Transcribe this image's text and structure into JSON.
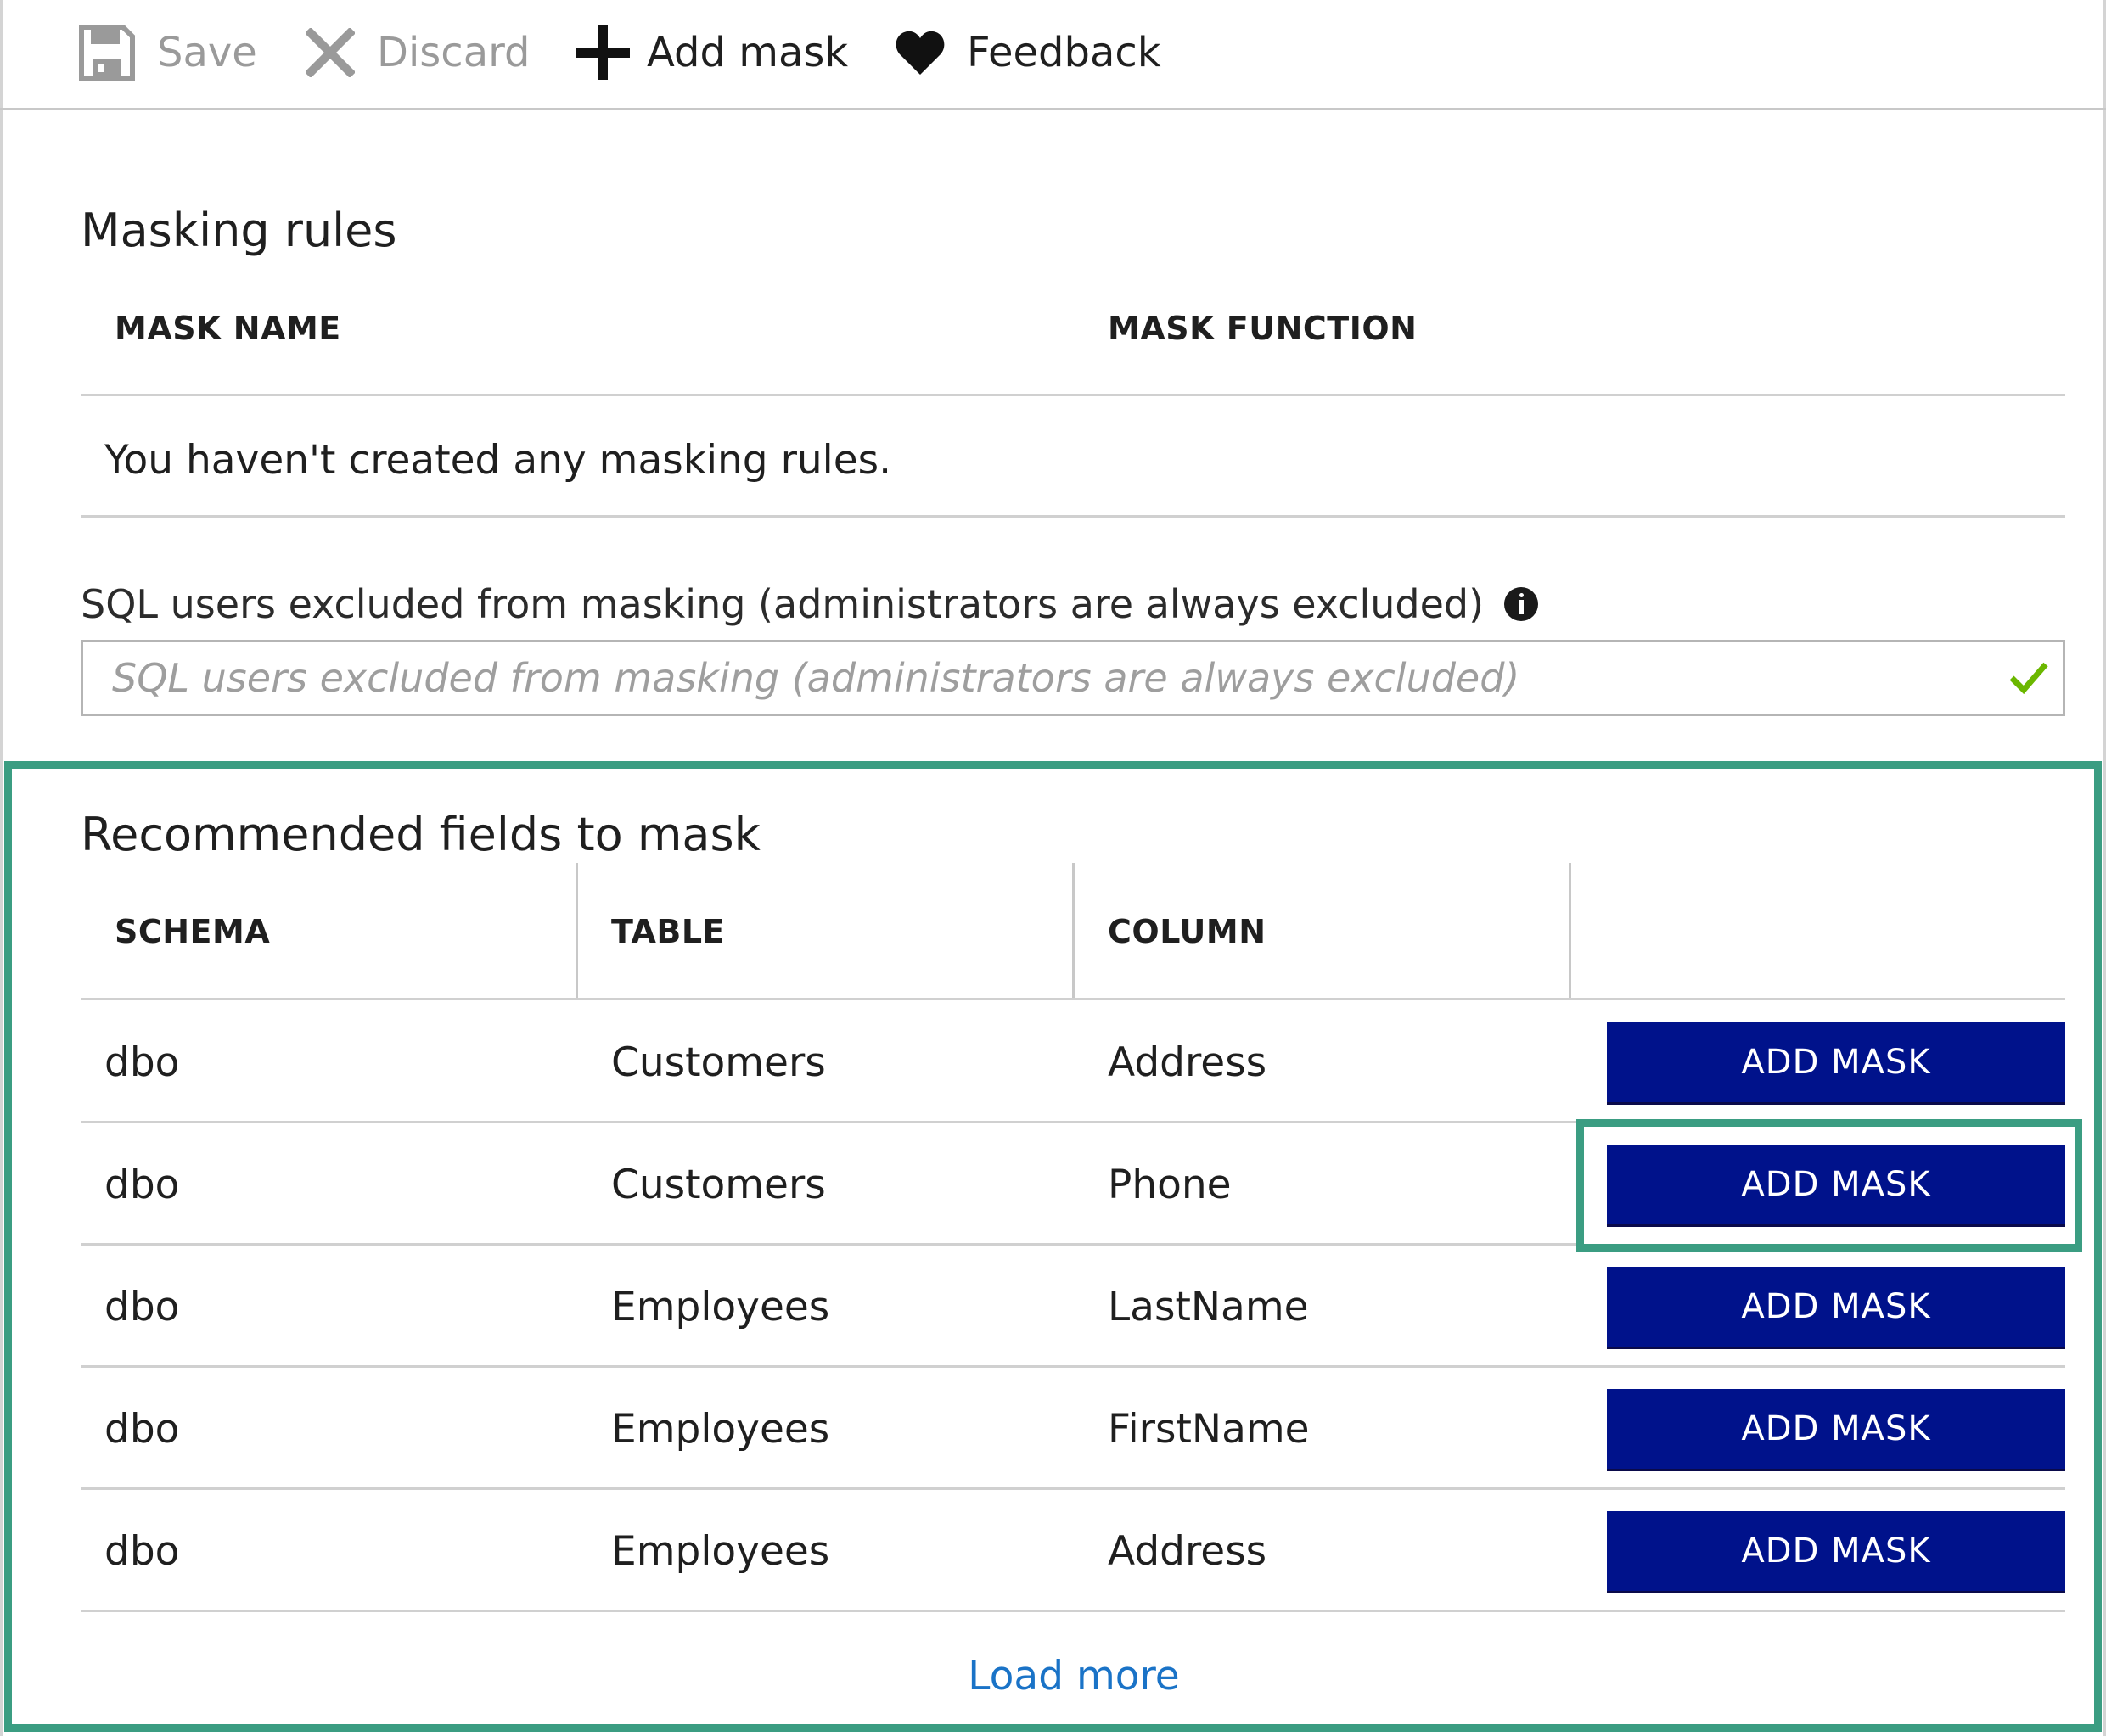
{
  "toolbar": {
    "save_label": "Save",
    "discard_label": "Discard",
    "add_mask_label": "Add mask",
    "feedback_label": "Feedback"
  },
  "masking_rules": {
    "title": "Masking rules",
    "columns": [
      "MASK NAME",
      "MASK FUNCTION"
    ],
    "empty_message": "You haven't created any masking rules."
  },
  "excluded_users": {
    "label": "SQL users excluded from masking (administrators are always excluded)",
    "placeholder": "SQL users excluded from masking (administrators are always excluded)",
    "value": ""
  },
  "recommended": {
    "title": "Recommended fields to mask",
    "columns": [
      "SCHEMA",
      "TABLE",
      "COLUMN"
    ],
    "rows": [
      {
        "schema": "dbo",
        "table": "Customers",
        "column": "Address",
        "action": "ADD MASK"
      },
      {
        "schema": "dbo",
        "table": "Customers",
        "column": "Phone",
        "action": "ADD MASK"
      },
      {
        "schema": "dbo",
        "table": "Employees",
        "column": "LastName",
        "action": "ADD MASK"
      },
      {
        "schema": "dbo",
        "table": "Employees",
        "column": "FirstName",
        "action": "ADD MASK"
      },
      {
        "schema": "dbo",
        "table": "Employees",
        "column": "Address",
        "action": "ADD MASK"
      }
    ],
    "load_more": "Load more"
  },
  "colors": {
    "accent_button": "#00128b",
    "highlight": "#3b9d82",
    "link": "#1a73c7",
    "valid_check": "#6bb700"
  }
}
